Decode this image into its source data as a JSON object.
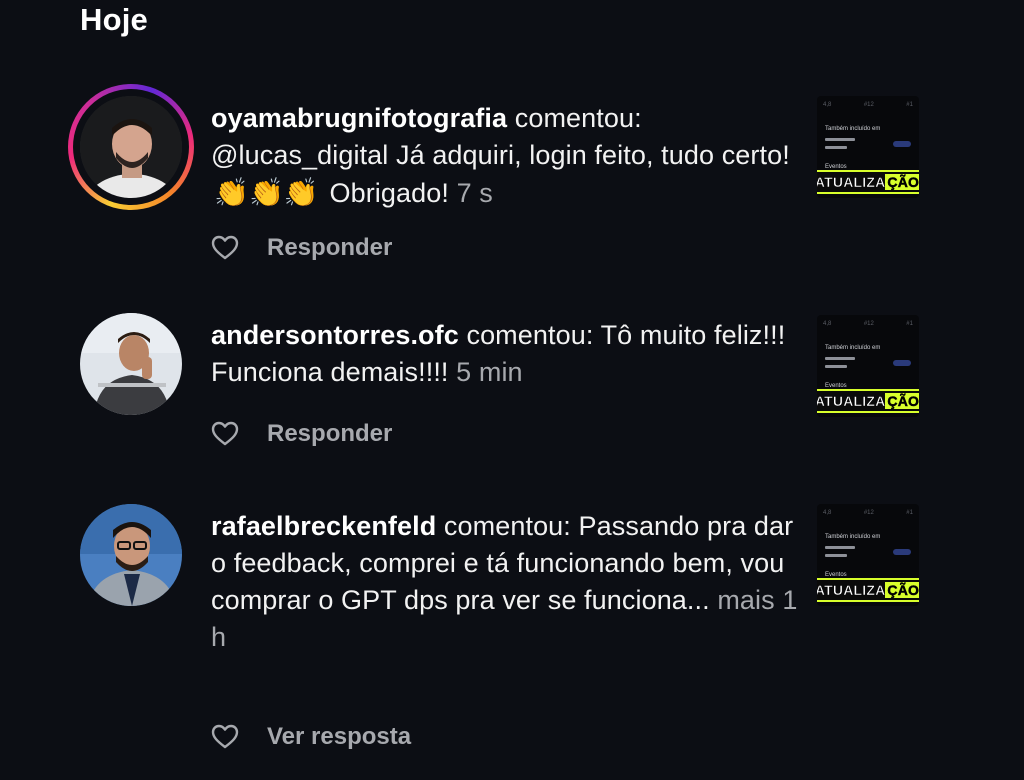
{
  "section_title": "Hoje",
  "reply_label": "Responder",
  "accent_colors": {
    "story_ring": "#ee2a7b",
    "badge_highlight": "#d8ff2b"
  },
  "notifications": [
    {
      "username": "oyamabrugnifotografia",
      "action": "comentou:",
      "comment_part1": "@lucas_digital Já adquiri, login feito, tudo certo!",
      "emoji": "👏👏👏",
      "comment_part2": "Obrigado!",
      "time": "7 s",
      "action_label": "Responder",
      "has_story_ring": true,
      "thumbnail_badge": "ATUALIZAÇÃO"
    },
    {
      "username": "andersontorres.ofc",
      "action": "comentou:",
      "comment": "Tô muito feliz!!! Funciona demais!!!!",
      "time": "5 min",
      "action_label": "Responder",
      "has_story_ring": false,
      "thumbnail_badge": "ATUALIZAÇÃO"
    },
    {
      "username": "rafaelbreckenfeld",
      "action": "comentou:",
      "comment": "Passando pra dar o feedback, comprei e tá funcionando bem, vou comprar o GPT dps pra ver se funciona...",
      "more": "mais",
      "time": "1 h",
      "action_label": "Ver resposta",
      "has_story_ring": false,
      "thumbnail_badge": "ATUALIZAÇÃO"
    }
  ],
  "icons": {
    "like": "heart-outline-icon"
  }
}
